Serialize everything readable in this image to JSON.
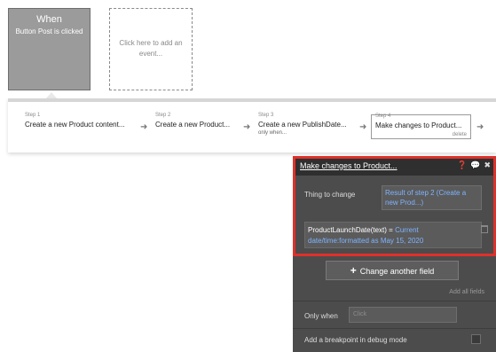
{
  "event": {
    "title": "When",
    "subtitle": "Button Post is clicked"
  },
  "add_event": {
    "label": "Click here to add an event..."
  },
  "steps": [
    {
      "label": "Step 1",
      "name": "Create a new Product content...",
      "meta": ""
    },
    {
      "label": "Step 2",
      "name": "Create a new Product...",
      "meta": ""
    },
    {
      "label": "Step 3",
      "name": "Create a new PublishDate...",
      "meta": "only when..."
    },
    {
      "label": "Step 4",
      "name": "Make changes to Product...",
      "meta": "delete"
    }
  ],
  "panel": {
    "title": "Make changes to Product...",
    "thing_label": "Thing to change",
    "thing_value": "Result of step 2 (Create a new Prod...)",
    "field_lhs": "ProductLaunchDate(text)  =",
    "field_rhs": "Current date/time:formatted as May 15, 2020",
    "change_button": "Change another field",
    "add_all": "Add all fields",
    "only_when_label": "Only when",
    "only_when_placeholder": "Click",
    "breakpoint_label": "Add a breakpoint in debug mode"
  },
  "icons": {
    "help": "help-icon",
    "comment": "comment-icon",
    "close": "close-icon",
    "trash": "trash-icon",
    "plus": "plus-icon",
    "arrow": "arrow-right-icon"
  },
  "colors": {
    "highlight": "#e0302a",
    "link_blue": "#7fb3ff",
    "panel_bg": "#4c4c4c"
  }
}
